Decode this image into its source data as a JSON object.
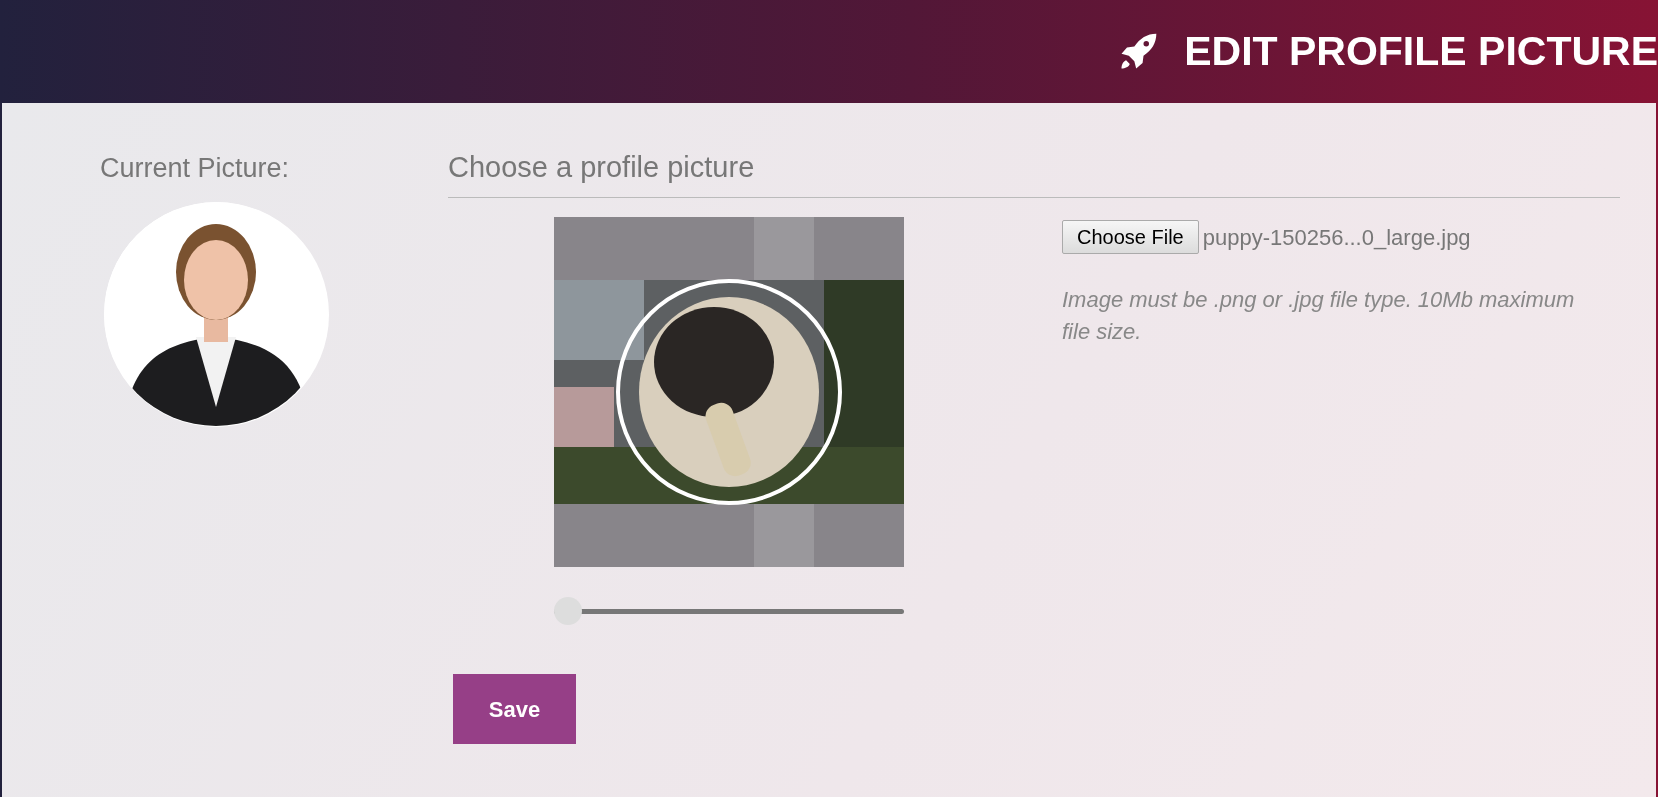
{
  "header": {
    "title": "EDIT PROFILE PICTURE"
  },
  "current": {
    "label": "Current Picture:"
  },
  "chooser": {
    "heading": "Choose a profile picture",
    "zoom_slider": {
      "level": 0
    },
    "file_button": "Choose File",
    "file_name": "puppy-150256...0_large.jpg",
    "hint": "Image must be .png or .jpg file type. 10Mb maximum file size."
  },
  "save_button": "Save"
}
